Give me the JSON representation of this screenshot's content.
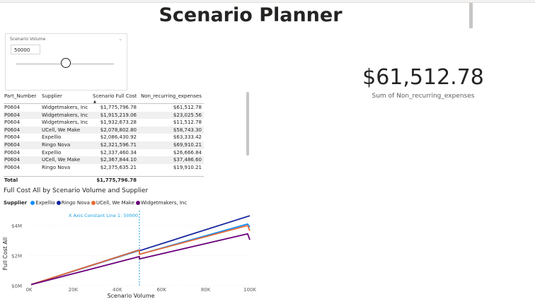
{
  "page": {
    "title": "Scenario Planner"
  },
  "slicer": {
    "title": "Scenario Volume",
    "value": "50000",
    "slider_fraction": 0.5
  },
  "card": {
    "value": "$61,512.78",
    "label": "Sum of Non_recurring_expenses"
  },
  "table": {
    "columns": [
      "Part_Number",
      "Supplier",
      "Scenario Full Cost",
      "Non_recurring_expenses"
    ],
    "sorted_column": "Scenario Full Cost",
    "rows": [
      [
        "P0604",
        "Widgetmakers, Inc",
        "$1,775,796.78",
        "$61,512.78"
      ],
      [
        "P0604",
        "Widgetmakers, Inc",
        "$1,915,219.06",
        "$23,025.56"
      ],
      [
        "P0604",
        "Widgetmakers, Inc",
        "$1,932,673.28",
        "$11,512.78"
      ],
      [
        "P0604",
        "UCell, We Make",
        "$2,078,802.80",
        "$58,743.30"
      ],
      [
        "P0604",
        "Expellio",
        "$2,086,430.92",
        "$63,333.42"
      ],
      [
        "P0604",
        "Ringo Nova",
        "$2,321,596.71",
        "$69,910.21"
      ],
      [
        "P0604",
        "Expellio",
        "$2,337,460.34",
        "$26,666.84"
      ],
      [
        "P0604",
        "UCell, We Make",
        "$2,367,844.10",
        "$37,486.60"
      ],
      [
        "P0604",
        "Ringo Nova",
        "$2,375,635.21",
        "$19,910.21"
      ]
    ],
    "total": {
      "label": "Total",
      "full_cost": "$1,775,796.78"
    }
  },
  "chart_data": {
    "type": "line",
    "title": "Full Cost All by Scenario Volume and Supplier",
    "legend_title": "Supplier",
    "xlabel": "Scenario Volume",
    "ylabel": "Full Cost All",
    "x_ticks": [
      "0K",
      "20K",
      "40K",
      "60K",
      "80K",
      "100K"
    ],
    "y_ticks": [
      "$0M",
      "$2M",
      "$4M"
    ],
    "xlim": [
      0,
      100000
    ],
    "ylim": [
      0,
      4800000
    ],
    "constant_line": {
      "label": "X Axis Constant Line 1: 50000",
      "x": 50000,
      "color": "#1ba1e2"
    },
    "series": [
      {
        "name": "Expellio",
        "color": "#118dff",
        "points": [
          [
            1000,
            70000
          ],
          [
            50000,
            2337460
          ],
          [
            50000,
            2086431
          ],
          [
            99000,
            4100000
          ],
          [
            100000,
            3900000
          ]
        ]
      },
      {
        "name": "Ringo Nova",
        "color": "#12239e",
        "points": [
          [
            1000,
            70000
          ],
          [
            50000,
            2375635
          ],
          [
            50000,
            2321597
          ],
          [
            100000,
            4650000
          ]
        ]
      },
      {
        "name": "UCell, We Make",
        "color": "#e66c37",
        "points": [
          [
            1000,
            70000
          ],
          [
            50000,
            2367844
          ],
          [
            50000,
            2078803
          ],
          [
            99000,
            4000000
          ],
          [
            100000,
            3650000
          ]
        ]
      },
      {
        "name": "Widgetmakers, Inc",
        "color": "#6b007b",
        "points": [
          [
            1000,
            70000
          ],
          [
            50000,
            1932673
          ],
          [
            50000,
            1775797
          ],
          [
            99000,
            3450000
          ],
          [
            100000,
            3050000
          ]
        ]
      }
    ]
  }
}
